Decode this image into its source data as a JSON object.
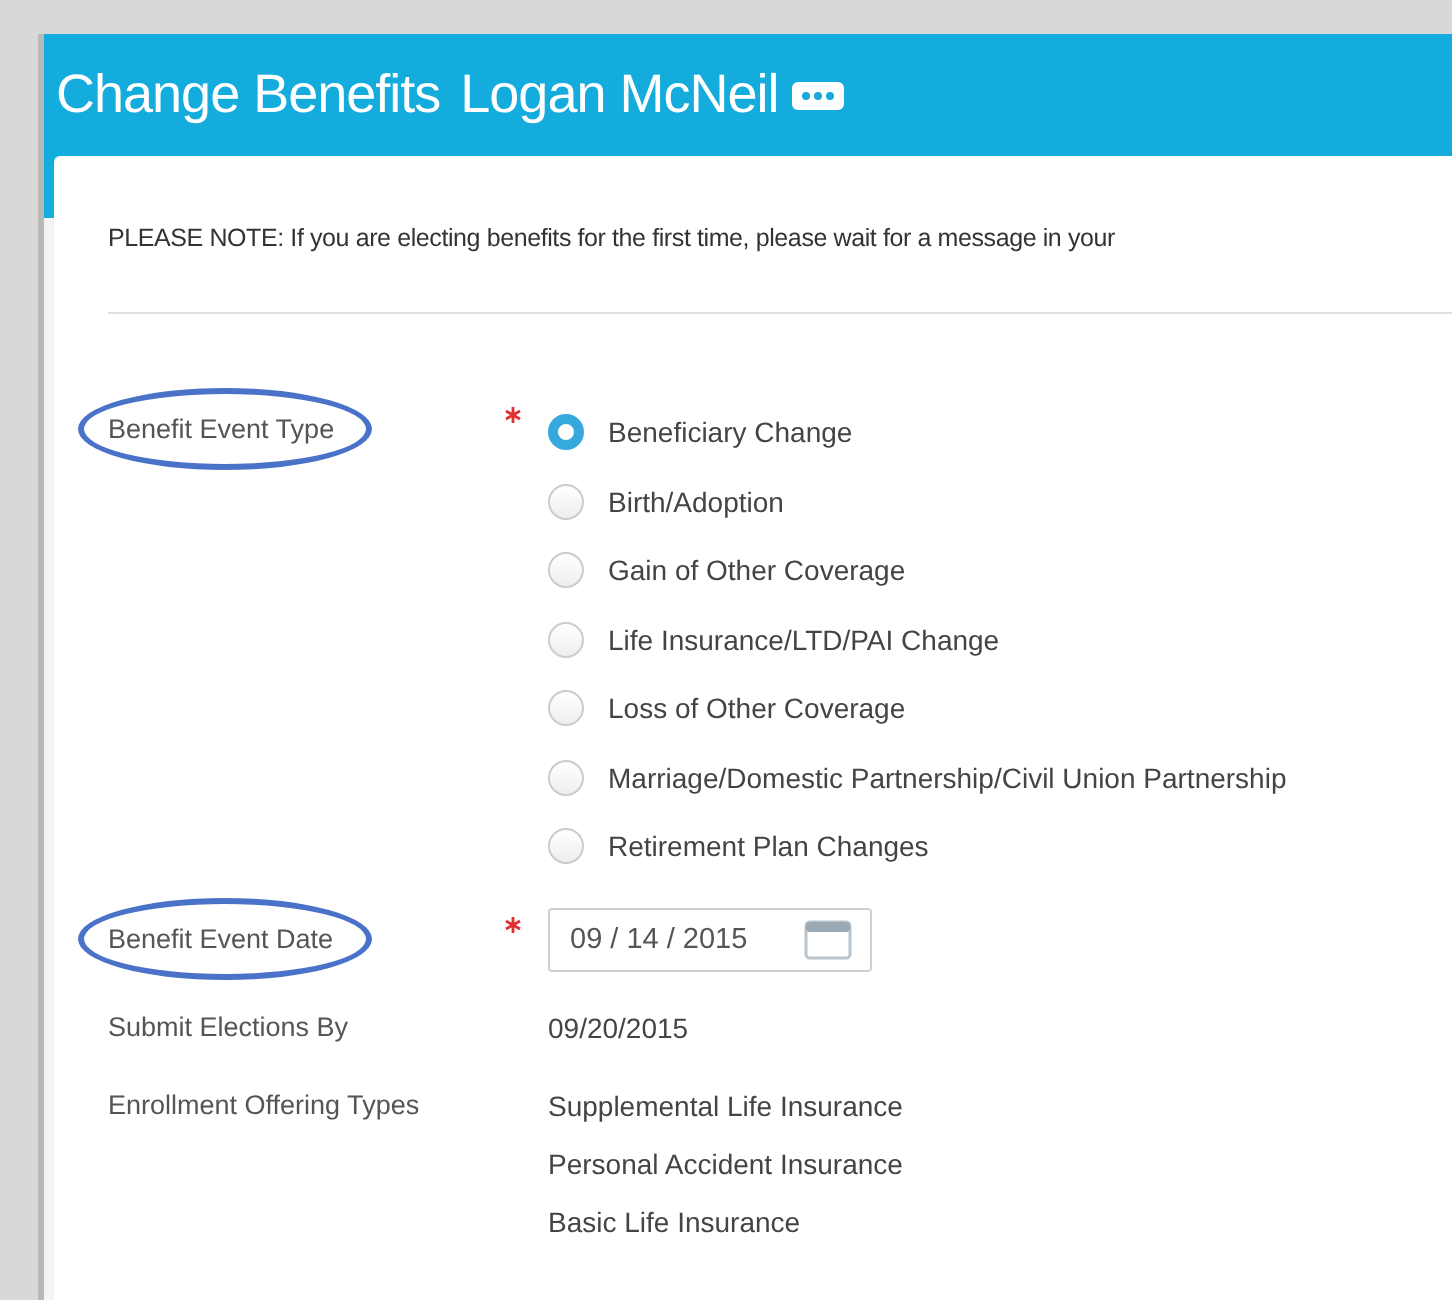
{
  "header": {
    "title": "Change Benefits",
    "name": "Logan McNeil"
  },
  "note": "PLEASE NOTE: If you are electing benefits for the first time, please wait for a message in your",
  "fields": [
    {
      "kind": "radio",
      "label": "Benefit Event Type",
      "required": true,
      "circled": true,
      "options": [
        {
          "label": "Beneficiary Change",
          "selected": true
        },
        {
          "label": "Birth/Adoption",
          "selected": false
        },
        {
          "label": "Gain of Other Coverage",
          "selected": false
        },
        {
          "label": "Life Insurance/LTD/PAI Change",
          "selected": false
        },
        {
          "label": "Loss of Other Coverage",
          "selected": false
        },
        {
          "label": "Marriage/Domestic Partnership/Civil Union Partnership",
          "selected": false
        },
        {
          "label": "Retirement Plan Changes",
          "selected": false
        }
      ]
    },
    {
      "kind": "date",
      "label": "Benefit Event Date",
      "required": true,
      "circled": true,
      "value": "09 / 14 / 2015"
    },
    {
      "kind": "text",
      "label": "Submit Elections By",
      "values": [
        "09/20/2015"
      ]
    },
    {
      "kind": "text",
      "label": "Enrollment Offering Types",
      "values": [
        "Supplemental Life Insurance",
        "Personal Accident Insurance",
        "Basic Life Insurance"
      ]
    }
  ]
}
